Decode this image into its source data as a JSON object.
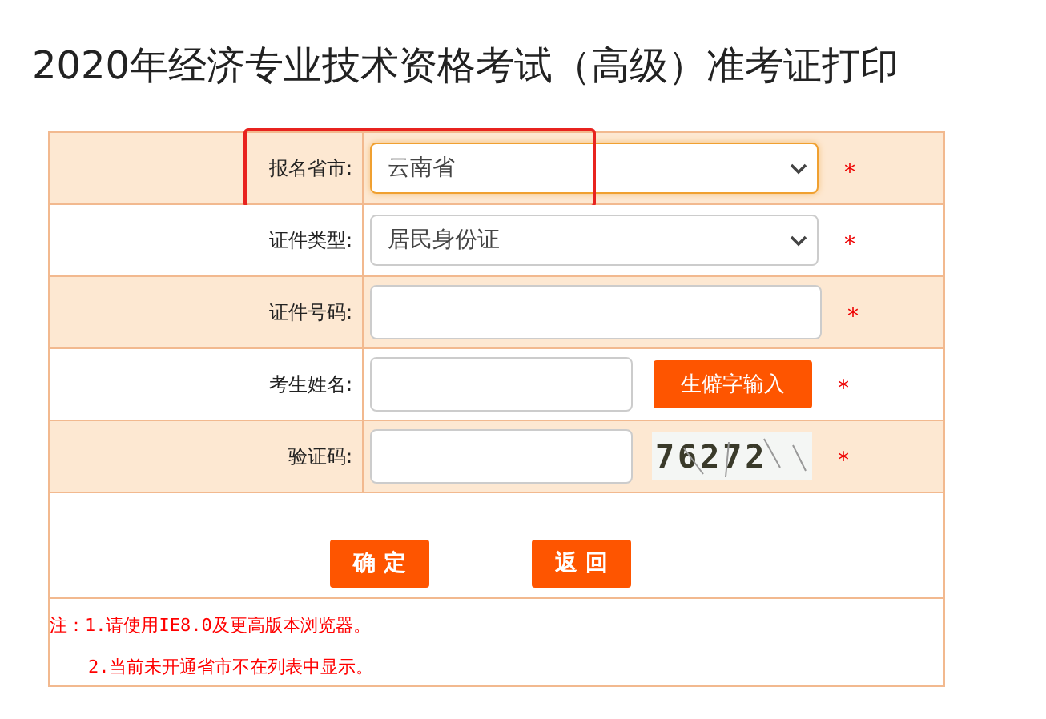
{
  "page": {
    "title": "2020年经济专业技术资格考试（高级）准考证打印"
  },
  "form": {
    "rows": [
      {
        "kind": "select",
        "label": "报名省市:",
        "value": "云南省",
        "required": "*",
        "highlighted": true
      },
      {
        "kind": "select",
        "label": "证件类型:",
        "value": "居民身份证",
        "required": "*",
        "highlighted": false
      },
      {
        "kind": "input",
        "label": "证件号码:",
        "required": "*",
        "highlighted": false
      },
      {
        "kind": "input_button",
        "label": "考生姓名:",
        "button": "生僻字输入",
        "required": "*",
        "highlighted": false
      },
      {
        "kind": "captcha",
        "label": "验证码:",
        "captcha": "76272",
        "required": "*",
        "highlighted": false
      }
    ],
    "buttons": [
      "确 定",
      "返 回"
    ],
    "notes": [
      "注：1.请使用IE8.0及更高版本浏览器。",
      "2.当前未开通省市不在列表中显示。"
    ]
  }
}
